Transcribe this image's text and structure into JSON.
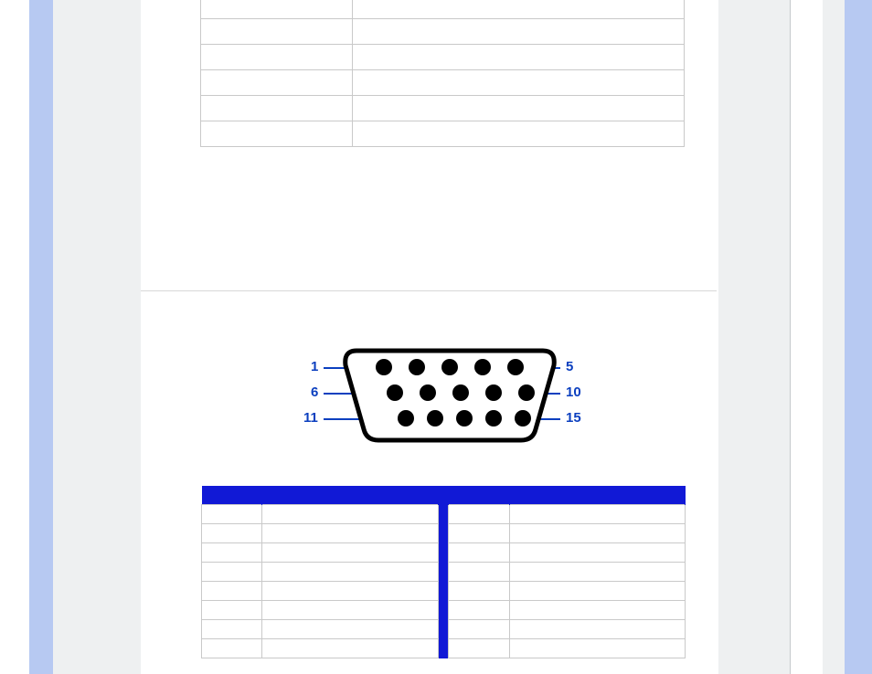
{
  "top_table": {
    "rows": [
      {
        "a": "",
        "b": ""
      },
      {
        "a": "",
        "b": ""
      },
      {
        "a": "",
        "b": ""
      },
      {
        "a": "",
        "b": ""
      },
      {
        "a": "",
        "b": ""
      },
      {
        "a": "",
        "b": ""
      }
    ]
  },
  "vga_diagram": {
    "labels": {
      "left_top": "1",
      "left_mid": "6",
      "left_bot": "11",
      "right_top": "5",
      "right_mid": "10",
      "right_bot": "15"
    }
  },
  "pin_table": {
    "headers": {
      "left_pin": "",
      "left_signal": "",
      "right_pin": "",
      "right_signal": ""
    },
    "rows": [
      {
        "lpin": "",
        "lsig": "",
        "rpin": "",
        "rsig": ""
      },
      {
        "lpin": "",
        "lsig": "",
        "rpin": "",
        "rsig": ""
      },
      {
        "lpin": "",
        "lsig": "",
        "rpin": "",
        "rsig": ""
      },
      {
        "lpin": "",
        "lsig": "",
        "rpin": "",
        "rsig": ""
      },
      {
        "lpin": "",
        "lsig": "",
        "rpin": "",
        "rsig": ""
      },
      {
        "lpin": "",
        "lsig": "",
        "rpin": "",
        "rsig": ""
      },
      {
        "lpin": "",
        "lsig": "",
        "rpin": "",
        "rsig": ""
      },
      {
        "lpin": "",
        "lsig": "",
        "rpin": "",
        "rsig": ""
      }
    ]
  }
}
